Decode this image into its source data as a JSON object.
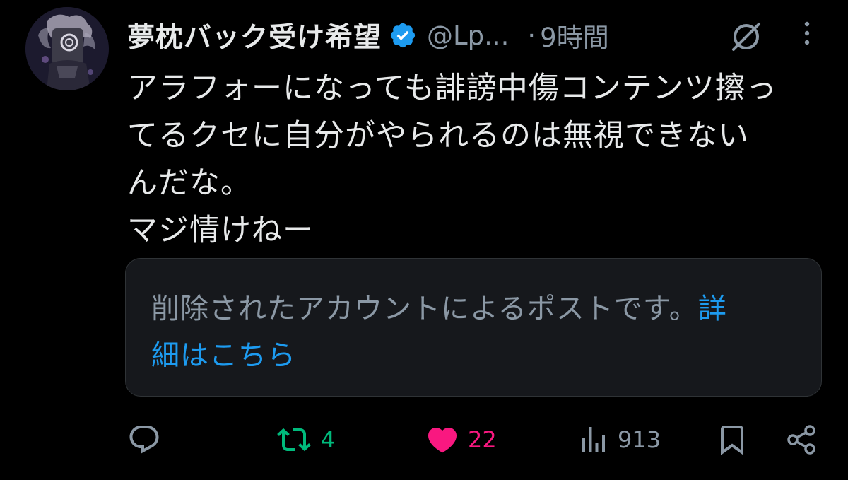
{
  "colors": {
    "background": "#000000",
    "text_primary": "#e7e9ea",
    "text_secondary": "#8b98a5",
    "link": "#1d9bf0",
    "verified": "#1d9bf0",
    "retweet_active": "#00ba7c",
    "like_active": "#f91880",
    "card_bg": "#16181c",
    "card_border": "#2f3336"
  },
  "tweet": {
    "author": {
      "display_name": "夢枕バック受け希望",
      "handle": "@Lp...",
      "verified": true,
      "avatar_icon": "avatar-image"
    },
    "separator": "·",
    "time": "9時間",
    "header_icons": [
      "grok-icon",
      "more-vertical-icon"
    ],
    "text": "アラフォーになっても誹謗中傷コンテンツ擦っ\nてるクセに自分がやられるのは無視できない\nんだな。\nマジ情けねー",
    "quote": {
      "message": "削除されたアカウントによるポストです。",
      "link_text": "詳\n細はこちら"
    },
    "actions": {
      "reply": {
        "icon": "reply-icon",
        "count": ""
      },
      "retweet": {
        "icon": "retweet-icon",
        "count": "4"
      },
      "like": {
        "icon": "heart-icon",
        "count": "22"
      },
      "views": {
        "icon": "analytics-icon",
        "count": "913"
      },
      "bookmark": {
        "icon": "bookmark-icon"
      },
      "share": {
        "icon": "share-icon"
      }
    }
  }
}
